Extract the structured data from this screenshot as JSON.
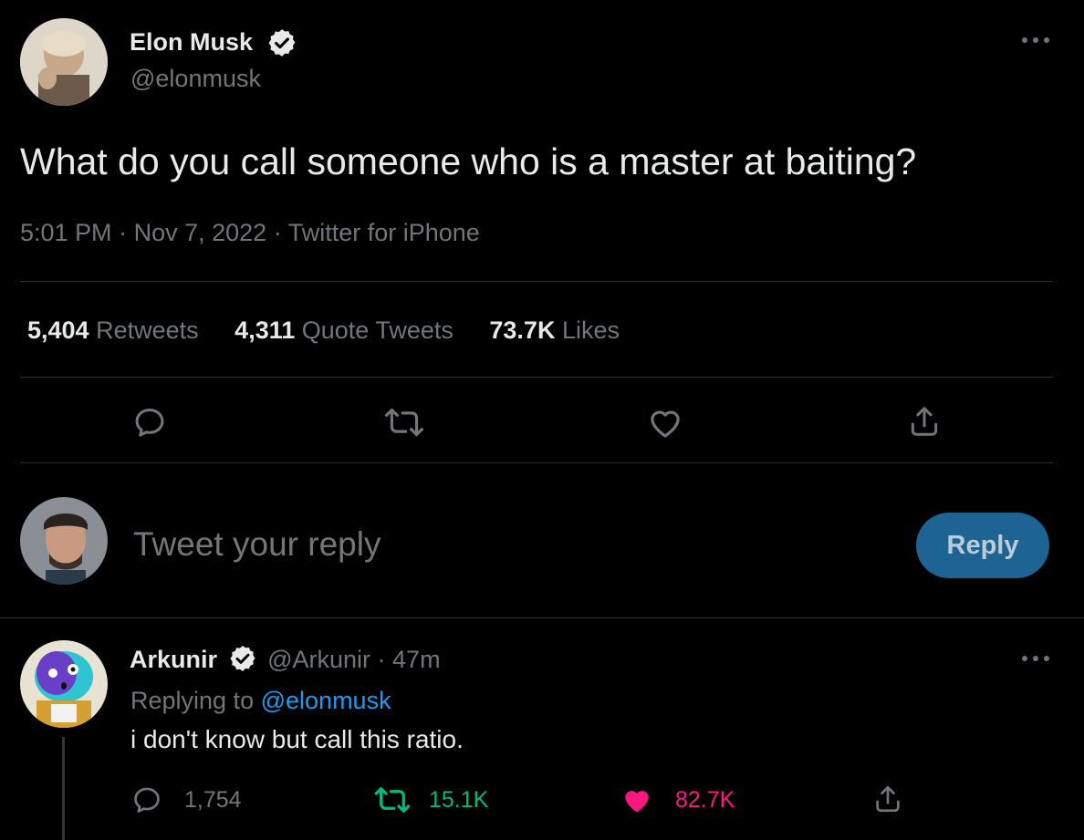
{
  "tweet": {
    "author_name": "Elon Musk",
    "author_handle": "@elonmusk",
    "text": "What do you call someone who is a master at baiting?",
    "time": "5:01 PM",
    "sep1": "·",
    "date": "Nov 7, 2022",
    "sep2": "·",
    "source": "Twitter for iPhone",
    "stats": {
      "retweets_count": "5,404",
      "retweets_label": "Retweets",
      "quotes_count": "4,311",
      "quotes_label": "Quote Tweets",
      "likes_count": "73.7K",
      "likes_label": "Likes"
    }
  },
  "composer": {
    "placeholder": "Tweet your reply",
    "reply_label": "Reply"
  },
  "reply": {
    "author_name": "Arkunir",
    "author_handle": "@Arkunir",
    "sep": "·",
    "age": "47m",
    "replying_prefix": "Replying to",
    "replying_handle": "@elonmusk",
    "text": "i don't know but call this ratio.",
    "replies_count": "1,754",
    "retweets_count": "15.1K",
    "likes_count": "82.7K"
  },
  "colors": {
    "background": "#000000",
    "divider": "#2f3336",
    "muted": "#71767b",
    "link": "#1d9bf0",
    "retweet_green": "#00ba7c",
    "like_pink": "#f91880",
    "reply_button": "#1d6393"
  }
}
